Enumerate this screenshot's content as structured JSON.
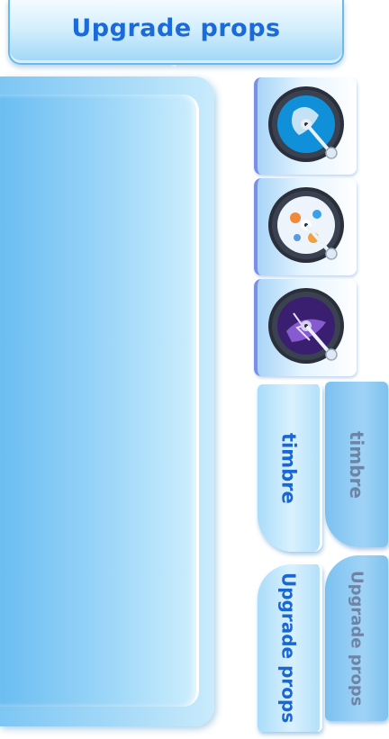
{
  "header": {
    "title": "Upgrade props"
  },
  "discs": [
    {
      "name": "disc-1",
      "icon": "record-disc-icon",
      "label_color": "#0e8fd8"
    },
    {
      "name": "disc-2",
      "icon": "record-disc-icon",
      "label_color": "#f2f6fb"
    },
    {
      "name": "disc-3",
      "icon": "record-disc-icon",
      "label_color": "#5a2fa8"
    }
  ],
  "tabs": {
    "timbre_active": "timbre",
    "timbre_inactive": "timbre",
    "props_active": "Upgrade props",
    "props_inactive": "Upgrade props"
  },
  "colors": {
    "accent_text": "#1a66d4",
    "inactive_text": "#6f84a5",
    "panel": "#9cd6f8"
  }
}
